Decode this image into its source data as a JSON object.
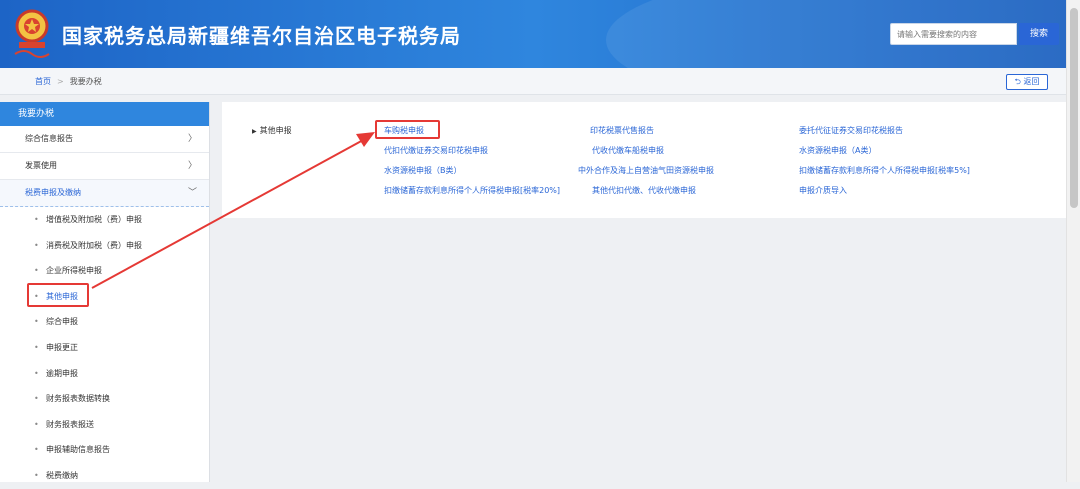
{
  "header": {
    "title": "国家税务总局新疆维吾尔自治区电子税务局",
    "search_placeholder": "请输入需要搜索的内容",
    "search_button": "搜索",
    "emblem_icon": "tax-emblem-icon"
  },
  "breadcrumb": {
    "home": "首页",
    "separator": ">",
    "current": "我要办税"
  },
  "back_button": "返回",
  "sidebar": {
    "header": "我要办税",
    "items": [
      {
        "label": "综合信息报告",
        "arrow": "〉"
      },
      {
        "label": "发票使用",
        "arrow": "〉"
      },
      {
        "label": "税费申报及缴纳",
        "arrow": "﹀"
      }
    ],
    "subitems": [
      "增值税及附加税（费）申报",
      "消费税及附加税（费）申报",
      "企业所得税申报",
      "其他申报",
      "综合申报",
      "申报更正",
      "逾期申报",
      "财务报表数据转换",
      "财务报表报送",
      "申报辅助信息报告",
      "税费缴纳"
    ],
    "active_subitem": "其他申报"
  },
  "content": {
    "category": "其他申报",
    "col1": [
      "车购税申报",
      "代扣代缴证券交易印花税申报",
      "水资源税申报（B类）",
      "扣缴储蓄存款利息所得个人所得税申报[税率20%]"
    ],
    "col2": [
      "印花税票代售报告",
      "代收代缴车船税申报",
      "中外合作及海上自营油气田资源税申报",
      "其他代扣代缴、代收代缴申报"
    ],
    "col3": [
      "委托代征证券交易印花税报告",
      "水资源税申报（A类）",
      "扣缴储蓄存款利息所得个人所得税申报[税率5%]",
      "申报介质导入"
    ]
  },
  "colors": {
    "header_blue": "#2f86de",
    "link_blue": "#2a66d6",
    "highlight_red": "#e53935"
  }
}
